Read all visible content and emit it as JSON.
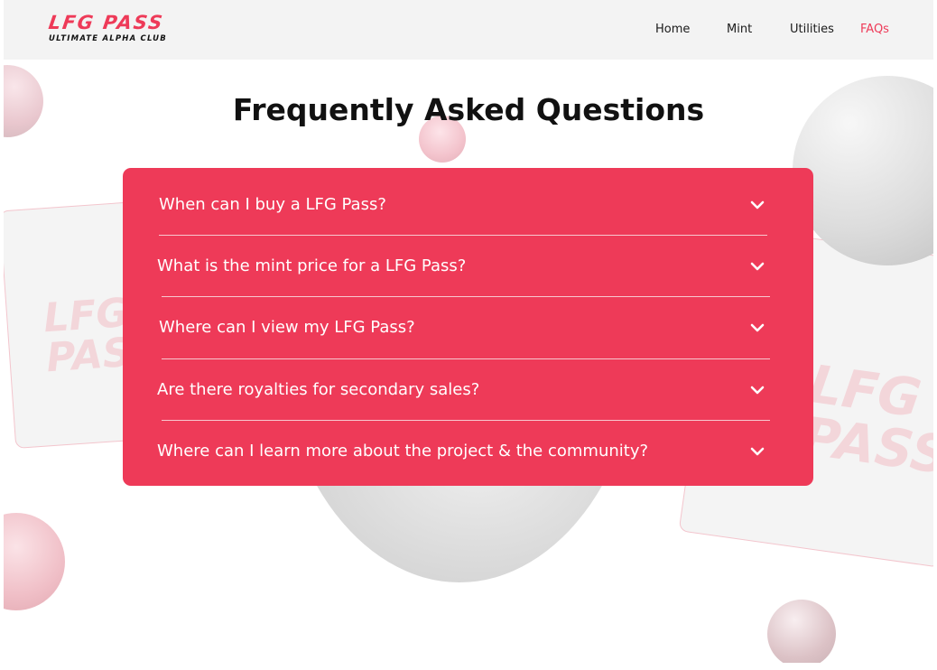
{
  "brand": {
    "name": "LFG PASS",
    "tagline": "ULTIMATE ALPHA CLUB",
    "accent": "#ee3a58"
  },
  "nav": {
    "items": [
      {
        "label": "Home",
        "active": false
      },
      {
        "label": "Mint",
        "active": false
      },
      {
        "label": "Utilities",
        "active": false
      },
      {
        "label": "FAQs",
        "active": true
      }
    ]
  },
  "main": {
    "title": "Frequently Asked Questions",
    "faqs": [
      {
        "question": "When can I buy a LFG Pass?",
        "icon": "chevron-down-icon"
      },
      {
        "question": "What is the mint price for a LFG Pass?",
        "icon": "chevron-down-icon"
      },
      {
        "question": "Where can I view my LFG  Pass?",
        "icon": "chevron-down-icon"
      },
      {
        "question": "Are there royalties for secondary sales?",
        "icon": "chevron-down-icon"
      },
      {
        "question": "Where can I learn more about the project & the community?",
        "icon": "chevron-down-icon"
      }
    ]
  },
  "decor": {
    "card_left_text": "LFG PASS",
    "card_right_text": "LFG PASS"
  }
}
